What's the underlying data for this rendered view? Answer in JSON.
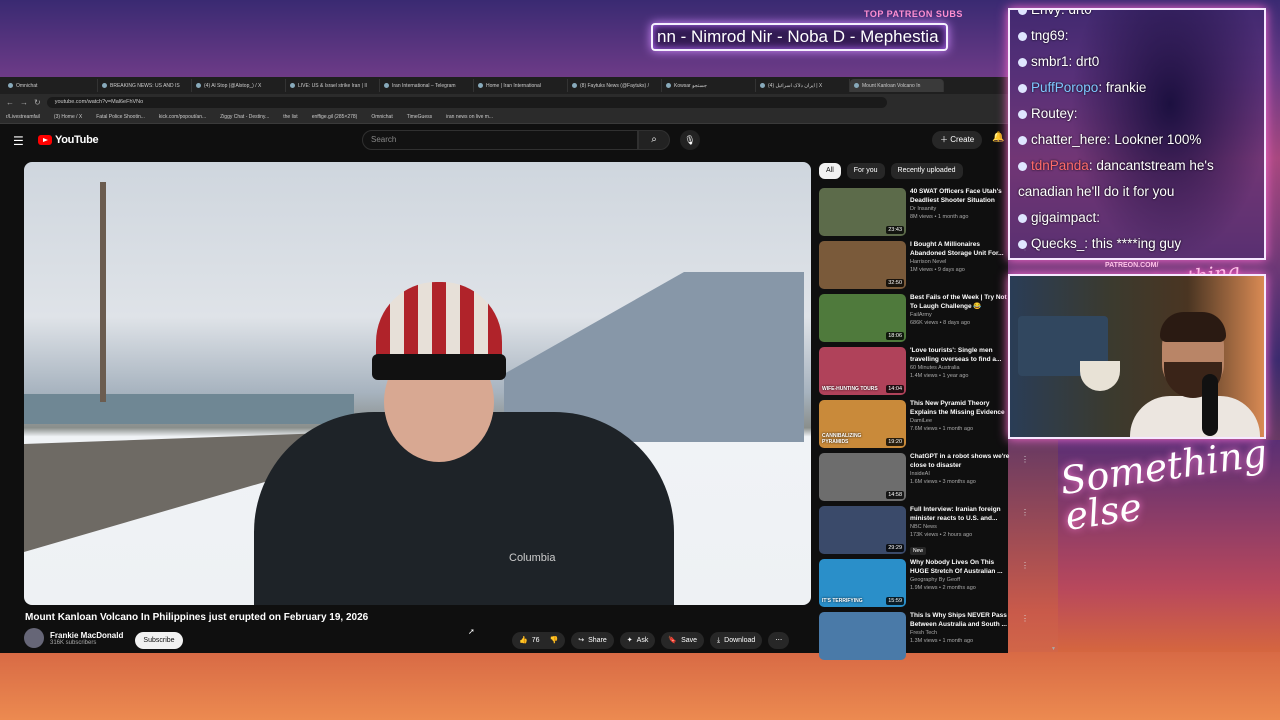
{
  "overlay": {
    "top_label": "TOP PATREON SUBS",
    "ticker": "nn - Nimrod Nir - Noba D - Mephestia",
    "patreon_url": "PATREON.COM/",
    "signature": "Something else",
    "signature_small": "Anything else"
  },
  "browser": {
    "tabs": [
      {
        "label": "Omnichat"
      },
      {
        "label": "BREAKING NEWS: US AND IS"
      },
      {
        "label": "(4) Al Stop (@Alstop_) / X"
      },
      {
        "label": "LIVE: US & Israel strike Iran | Il"
      },
      {
        "label": "Iran International – Telegram"
      },
      {
        "label": "Home | Iran International"
      },
      {
        "label": "(8) Faytuks News (@Faytuks) /"
      },
      {
        "label": "Kowsar جستجو"
      },
      {
        "label": "ایران دلاک اسرائیل (4) | X"
      },
      {
        "label": "Mount Kanloan Volcano In"
      }
    ],
    "url": "youtube.com/watch?v=Mal6eFhVNo",
    "bookmarks": [
      "r/Livestreamfail",
      "(3) Home / X",
      "Fatal Police Shootin...",
      "kick.com/popout/an...",
      "Ziggy Chat - Destiny...",
      "the list",
      "enffige.gil (285×278)",
      "Omnichat",
      "TimeGuess",
      "iran news on live m..."
    ]
  },
  "youtube": {
    "logo": "YouTube",
    "search_placeholder": "Search",
    "create_label": "Create",
    "video": {
      "title": "Mount Kanloan Volcano In Philippines just erupted on February 19, 2026",
      "channel": "Frankie MacDonald",
      "subscribers": "316K subscribers",
      "subscribe_label": "Subscribe",
      "likes": "76",
      "share": "Share",
      "ask": "Ask",
      "save": "Save",
      "download": "Download",
      "jacket_brand": "Columbia"
    },
    "chips": [
      "All",
      "For you",
      "Recently uploaded"
    ],
    "recommendations": [
      {
        "title": "40 SWAT Officers Face Utah's Deadliest Shooter Situation",
        "channel": "Dr Insanity",
        "meta": "8M views • 1 month ago",
        "duration": "23:43",
        "color": "#5c6b4a"
      },
      {
        "title": "I Bought A Millionaires Abandoned Storage Unit For...",
        "channel": "Harrison Nevel",
        "meta": "1M views • 9 days ago",
        "duration": "32:50",
        "color": "#7a5a3a"
      },
      {
        "title": "Best Fails of the Week | Try Not To Laugh Challenge 😂",
        "channel": "FailArmy",
        "meta": "686K views • 8 days ago",
        "duration": "18:06",
        "color": "#4f7a3c"
      },
      {
        "title": "'Love tourists': Single men travelling overseas to find a...",
        "channel": "60 Minutes Australia",
        "meta": "1.4M views • 1 year ago",
        "duration": "14:04",
        "color": "#b0425a",
        "badge": "WIFE-HUNTING TOURS"
      },
      {
        "title": "This New Pyramid Theory Explains the Missing Evidence",
        "channel": "DamiLee",
        "meta": "7.6M views • 1 month ago",
        "duration": "19:20",
        "color": "#c98a3a",
        "badge": "CANNIBALIZING PYRAMIDS"
      },
      {
        "title": "ChatGPT in a robot shows we're close to disaster",
        "channel": "InsideAI",
        "meta": "1.6M views • 3 months ago",
        "duration": "14:58",
        "color": "#6d6d6d"
      },
      {
        "title": "Full Interview: Iranian foreign minister reacts to U.S. and...",
        "channel": "NBC News",
        "meta": "173K views • 2 hours ago",
        "duration": "29:29",
        "color": "#3a4a6a",
        "tag": "New"
      },
      {
        "title": "Why Nobody Lives On This HUGE Stretch Of Australian ...",
        "channel": "Geography By Geoff",
        "meta": "1.9M views • 2 months ago",
        "duration": "15:59",
        "color": "#2a8fc9",
        "badge": "IT'S TERRIFYING"
      },
      {
        "title": "This Is Why Ships NEVER Pass Between Australia and South ...",
        "channel": "Fresh Tech",
        "meta": "1.3M views • 1 month ago",
        "duration": "",
        "color": "#4a7aa8"
      }
    ]
  },
  "chat": [
    {
      "user": "Envy",
      "text": "drt0",
      "color": "#ffffff"
    },
    {
      "user": "tng69",
      "text": "",
      "color": "#ffffff"
    },
    {
      "user": "smbr1",
      "text": "drt0",
      "color": "#ffffff"
    },
    {
      "user": "PuffPoropo",
      "text": "frankie",
      "color": "#7fc8ff"
    },
    {
      "user": "Routey",
      "text": "",
      "color": "#ffffff"
    },
    {
      "user": "chatter_here",
      "text": "Lookner 100%",
      "color": "#ffffff"
    },
    {
      "user": "tdnPanda",
      "text": "dancantstream he's",
      "color": "#ff6b6b"
    },
    {
      "user": "",
      "text": "canadian he'll do it for you",
      "color": "#ffffff"
    },
    {
      "user": "gigaimpact",
      "text": "",
      "color": "#ffffff"
    },
    {
      "user": "Quecks_",
      "text": "this ****ing guy",
      "color": "#ffffff"
    }
  ]
}
